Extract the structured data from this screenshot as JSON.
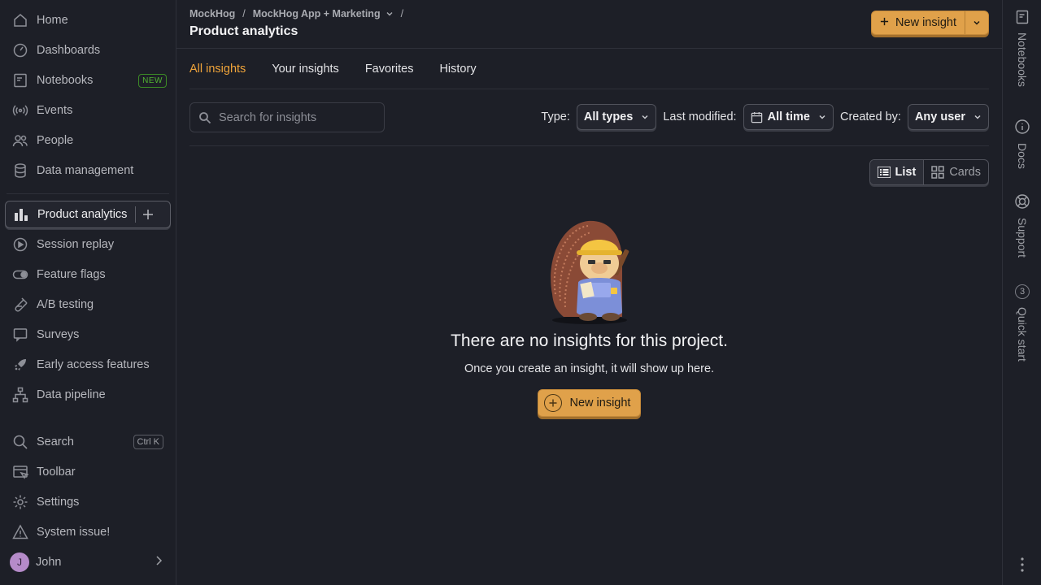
{
  "sidebar": {
    "items": [
      {
        "label": "Home",
        "icon": "home-icon"
      },
      {
        "label": "Dashboards",
        "icon": "dashboard-icon"
      },
      {
        "label": "Notebooks",
        "icon": "notebook-icon",
        "badge": "NEW"
      },
      {
        "label": "Events",
        "icon": "broadcast-icon"
      },
      {
        "label": "People",
        "icon": "people-icon"
      },
      {
        "label": "Data management",
        "icon": "database-icon"
      },
      {
        "label": "Product analytics",
        "icon": "bar-chart-icon",
        "active": true
      },
      {
        "label": "Session replay",
        "icon": "replay-icon"
      },
      {
        "label": "Feature flags",
        "icon": "toggle-icon"
      },
      {
        "label": "A/B testing",
        "icon": "flask-icon"
      },
      {
        "label": "Surveys",
        "icon": "survey-icon"
      },
      {
        "label": "Early access features",
        "icon": "rocket-icon"
      },
      {
        "label": "Data pipeline",
        "icon": "pipeline-icon"
      }
    ],
    "bottom": {
      "search_label": "Search",
      "search_shortcut": "Ctrl K",
      "toolbar_label": "Toolbar",
      "settings_label": "Settings",
      "system_issue_label": "System issue!",
      "user_name": "John",
      "user_initial": "J"
    }
  },
  "header": {
    "breadcrumb": [
      "MockHog",
      "MockHog App + Marketing"
    ],
    "title": "Product analytics",
    "new_insight_label": "New insight"
  },
  "tabs": [
    "All insights",
    "Your insights",
    "Favorites",
    "History"
  ],
  "active_tab": "All insights",
  "filters": {
    "search_placeholder": "Search for insights",
    "type_label": "Type:",
    "type_value": "All types",
    "modified_label": "Last modified:",
    "modified_value": "All time",
    "created_label": "Created by:",
    "created_value": "Any user"
  },
  "view_toggle": {
    "list": "List",
    "cards": "Cards",
    "active": "List"
  },
  "empty_state": {
    "title": "There are no insights for this project.",
    "subtitle": "Once you create an insight, it will show up here.",
    "button": "New insight"
  },
  "right_rail": {
    "items": [
      "Notebooks",
      "Docs",
      "Support",
      "Quick start"
    ],
    "quick_start_count": "3"
  },
  "colors": {
    "accent": "#e0a14a",
    "active_tab": "#f0a43a",
    "background": "#1d1f27",
    "badge_new": "#52b432",
    "avatar": "#b58bc9"
  }
}
